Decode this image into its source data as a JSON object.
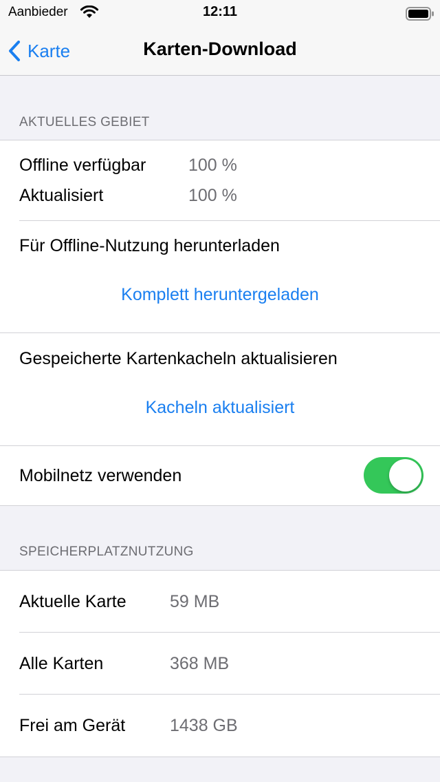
{
  "status_bar": {
    "carrier": "Aanbieder",
    "time": "12:11",
    "icons": [
      "wifi-icon",
      "battery-icon"
    ]
  },
  "nav": {
    "back_label": "Karte",
    "title": "Karten-Download",
    "accent_color": "#1a7ff0"
  },
  "current_area": {
    "header": "AKTUELLES GEBIET",
    "offline_label": "Offline verfügbar",
    "offline_value": "100 %",
    "updated_label": "Aktualisiert",
    "updated_value": "100 %",
    "download_label": "Für Offline-Nutzung herunterladen",
    "download_status": "Komplett heruntergeladen",
    "update_tiles_label": "Gespeicherte Kartenkacheln aktualisieren",
    "update_tiles_status": "Kacheln aktualisiert",
    "mobile_label": "Mobilnetz verwenden",
    "mobile_enabled": true,
    "toggle_color": "#34c759"
  },
  "storage": {
    "header": "SPEICHERPLATZNUTZUNG",
    "rows": [
      {
        "label": "Aktuelle Karte",
        "value": "59 MB"
      },
      {
        "label": "Alle Karten",
        "value": "368 MB"
      },
      {
        "label": "Frei am Gerät",
        "value": "1438 GB"
      }
    ]
  }
}
